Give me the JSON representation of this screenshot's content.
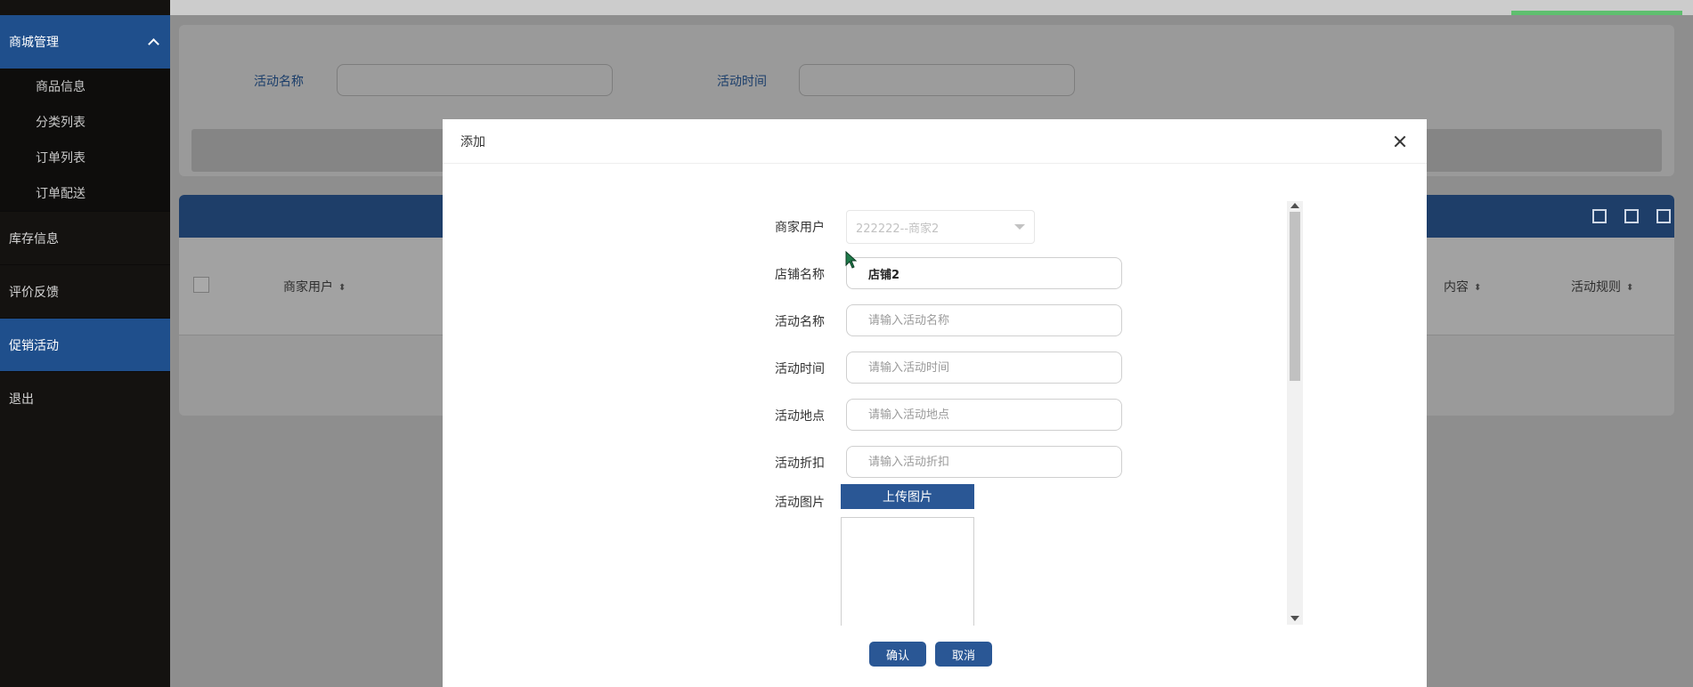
{
  "sidebar": {
    "group": {
      "label": "商城管理"
    },
    "sub_items": [
      {
        "label": "商品信息"
      },
      {
        "label": "分类列表"
      },
      {
        "label": "订单列表"
      },
      {
        "label": "订单配送"
      }
    ],
    "items": [
      {
        "label": "库存信息",
        "active": false
      },
      {
        "label": "评价反馈",
        "active": false
      },
      {
        "label": "促销活动",
        "active": true
      },
      {
        "label": "退出",
        "active": false
      }
    ]
  },
  "search": {
    "activity_name_label": "活动名称",
    "activity_time_label": "活动时间"
  },
  "table": {
    "headers": [
      "商家用户",
      "内容",
      "活动规则"
    ]
  },
  "modal": {
    "title": "添加",
    "fields": {
      "merchant_user": {
        "label": "商家用户",
        "value": "222222--商家2"
      },
      "shop_name": {
        "label": "店铺名称",
        "value": "店铺2"
      },
      "activity_name": {
        "label": "活动名称",
        "placeholder": "请输入活动名称"
      },
      "activity_time": {
        "label": "活动时间",
        "placeholder": "请输入活动时间"
      },
      "activity_location": {
        "label": "活动地点",
        "placeholder": "请输入活动地点"
      },
      "activity_discount": {
        "label": "活动折扣",
        "placeholder": "请输入活动折扣"
      },
      "activity_image": {
        "label": "活动图片",
        "upload_label": "上传图片"
      }
    },
    "confirm_label": "确认",
    "cancel_label": "取消"
  },
  "colors": {
    "brand": "#1f4f8c",
    "button": "#2a5795",
    "sidebar_bg": "#141210",
    "green_indicator": "#5fbf6f"
  }
}
